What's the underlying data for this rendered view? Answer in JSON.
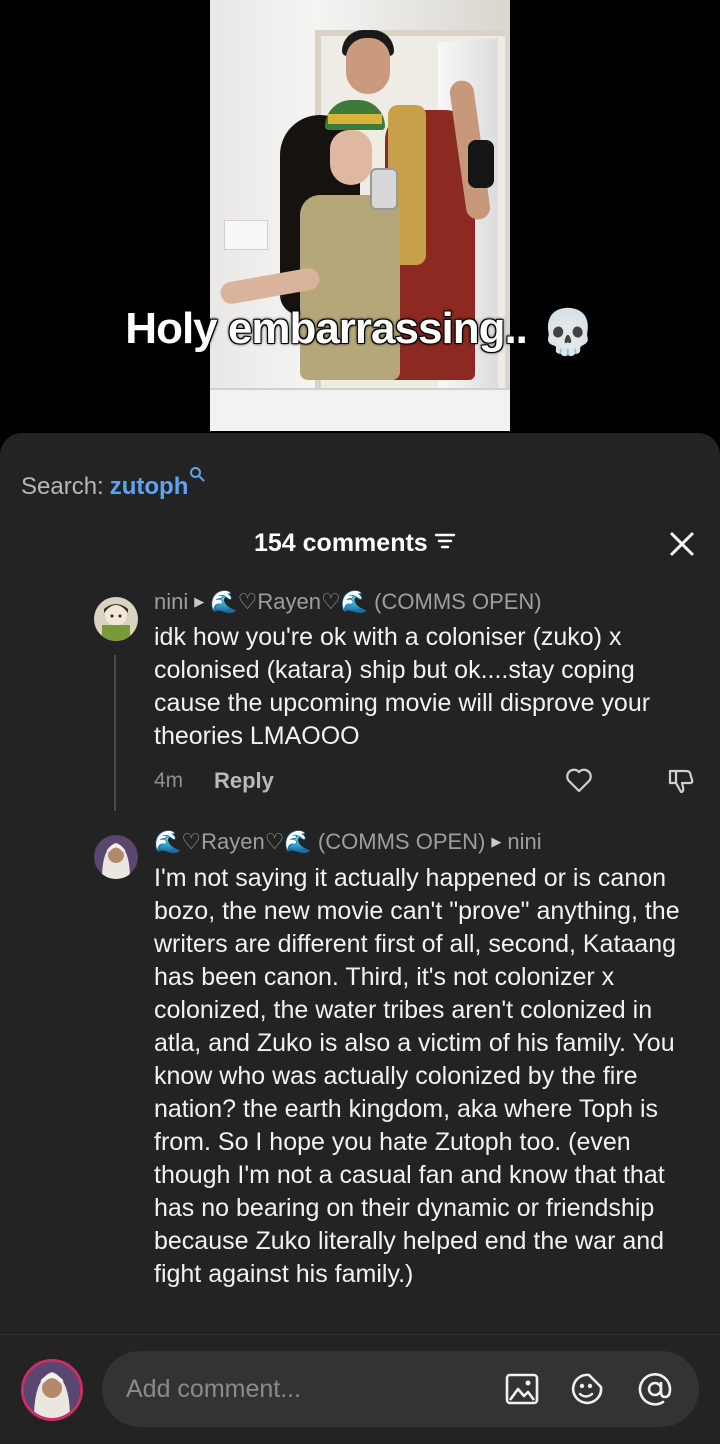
{
  "video": {
    "caption": "Holy embarrassing..",
    "caption_emoji": "💀"
  },
  "search": {
    "label": "Search:",
    "term": "zutoph",
    "icon": "search-icon"
  },
  "comments_header": {
    "count_label": "154 comments",
    "filter_icon": "filter-icon",
    "close_icon": "close-icon"
  },
  "comments": [
    {
      "author": "nini",
      "reply_to": "🌊♡Rayen♡🌊 (COMMS OPEN)",
      "text": "idk how you're ok with a coloniser (zuko) x colonised (katara) ship but ok....stay coping cause the upcoming movie will disprove your theories LMAOOO",
      "time": "4m",
      "reply_label": "Reply"
    },
    {
      "author": "🌊♡Rayen♡🌊 (COMMS OPEN)",
      "reply_to": "nini",
      "text": "I'm not saying it actually happened or is canon bozo, the new movie can't \"prove\" anything, the writers are different first of all, second, Kataang has been canon. Third, it's not colonizer x colonized, the water tribes aren't colonized in atla, and Zuko is also a victim of his family. You know who was actually colonized by the fire nation? the earth kingdom, aka where Toph is from. So I hope you hate Zutoph too. (even though I'm not a casual fan and know that that has no bearing on their dynamic or friendship because Zuko literally helped end the war and fight against his family.)"
    }
  ],
  "composer": {
    "placeholder": "Add comment...",
    "icons": [
      "image-icon",
      "emoji-icon",
      "mention-icon"
    ]
  },
  "colors": {
    "sheet_bg": "#232323",
    "search_term": "#5fa3f5",
    "input_bg": "#333333"
  }
}
